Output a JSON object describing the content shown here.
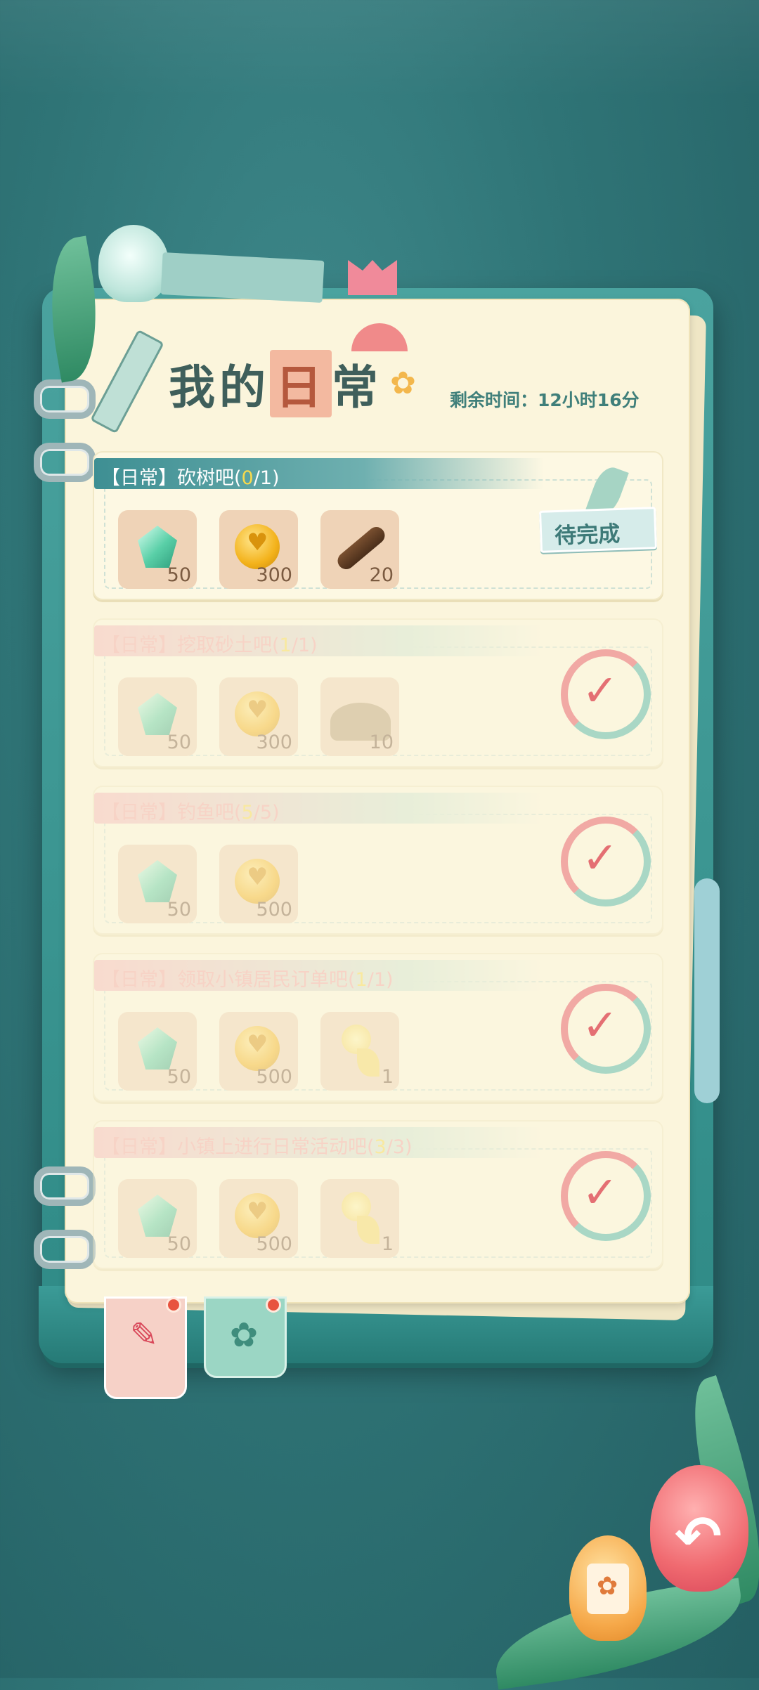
{
  "header": {
    "title_part1": "我的",
    "title_part2": "日",
    "title_part3": "常",
    "timer_label": "剩余时间：",
    "timer_value": "12小时16分"
  },
  "tasks": [
    {
      "prefix": "【日常】",
      "name": "砍树吧(",
      "progress_done": "0",
      "progress_total": "/1)",
      "status": "pending",
      "status_label": "待完成",
      "rewards": [
        {
          "icon": "green-gem-icon",
          "count": "50"
        },
        {
          "icon": "gold-coin-icon",
          "count": "300"
        },
        {
          "icon": "wood-log-icon",
          "count": "20"
        }
      ]
    },
    {
      "prefix": "【日常】",
      "name": "挖取砂土吧(",
      "progress_done": "1",
      "progress_total": "/1)",
      "status": "completed",
      "rewards": [
        {
          "icon": "green-gem-icon",
          "count": "50"
        },
        {
          "icon": "gold-coin-icon",
          "count": "300"
        },
        {
          "icon": "sand-pile-icon",
          "count": "10"
        }
      ]
    },
    {
      "prefix": "【日常】",
      "name": "钓鱼吧(",
      "progress_done": "5",
      "progress_total": "/5)",
      "status": "completed",
      "rewards": [
        {
          "icon": "green-gem-icon",
          "count": "50"
        },
        {
          "icon": "gold-coin-icon",
          "count": "500"
        }
      ]
    },
    {
      "prefix": "【日常】",
      "name": "领取小镇居民订单吧(",
      "progress_done": "1",
      "progress_total": "/1)",
      "status": "completed",
      "rewards": [
        {
          "icon": "green-gem-icon",
          "count": "50"
        },
        {
          "icon": "gold-coin-icon",
          "count": "500"
        },
        {
          "icon": "yellow-flower-icon",
          "count": "1"
        }
      ]
    },
    {
      "prefix": "【日常】",
      "name": "小镇上进行日常活动吧(",
      "progress_done": "3",
      "progress_total": "/3)",
      "status": "completed",
      "rewards": [
        {
          "icon": "green-gem-icon",
          "count": "50"
        },
        {
          "icon": "gold-coin-icon",
          "count": "500"
        },
        {
          "icon": "yellow-flower-icon",
          "count": "1"
        }
      ]
    }
  ],
  "tabs": [
    {
      "icon": "daily-notes-icon",
      "badge": true
    },
    {
      "icon": "flower-icon",
      "badge": true
    }
  ],
  "corner_buttons": {
    "back": "back-arrow-icon",
    "yellow": "flower-card-icon"
  },
  "colors": {
    "background": "#2f7476",
    "page": "#fbf5dc",
    "banner": "#3e8f93",
    "progress_highlight": "#f7d94c",
    "check": "#e46f73"
  }
}
